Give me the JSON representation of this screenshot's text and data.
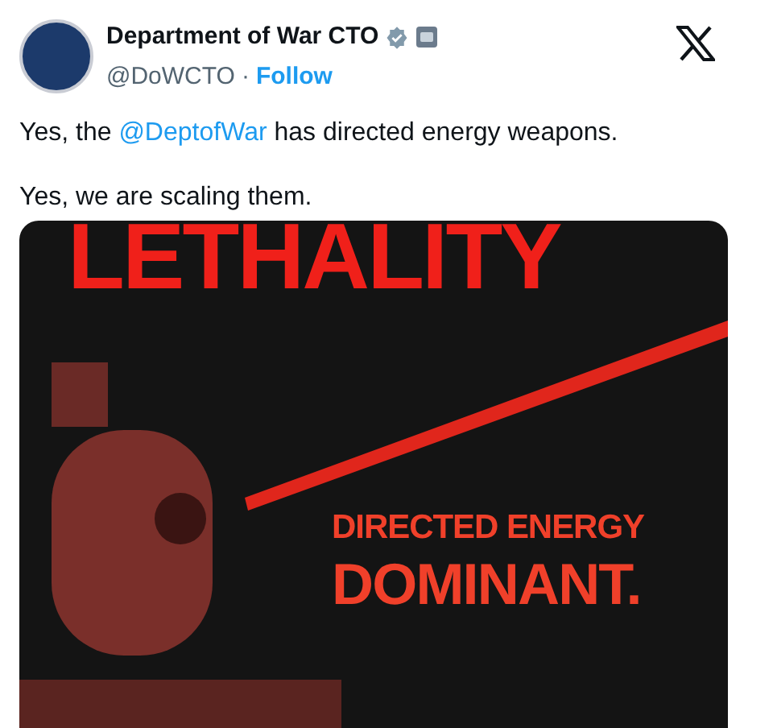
{
  "author": {
    "name": "Department of War CTO",
    "handle": "@DoWCTO",
    "separator": "·",
    "follow": "Follow"
  },
  "text": {
    "before": "Yes, the ",
    "mention": "@DeptofWar",
    "after": " has directed energy weapons.",
    "line_2": "Yes, we are scaling them."
  },
  "image": {
    "headline": "LETHALITY",
    "line_1": "DIRECTED ENERGY",
    "line_2": "DOMINANT."
  }
}
